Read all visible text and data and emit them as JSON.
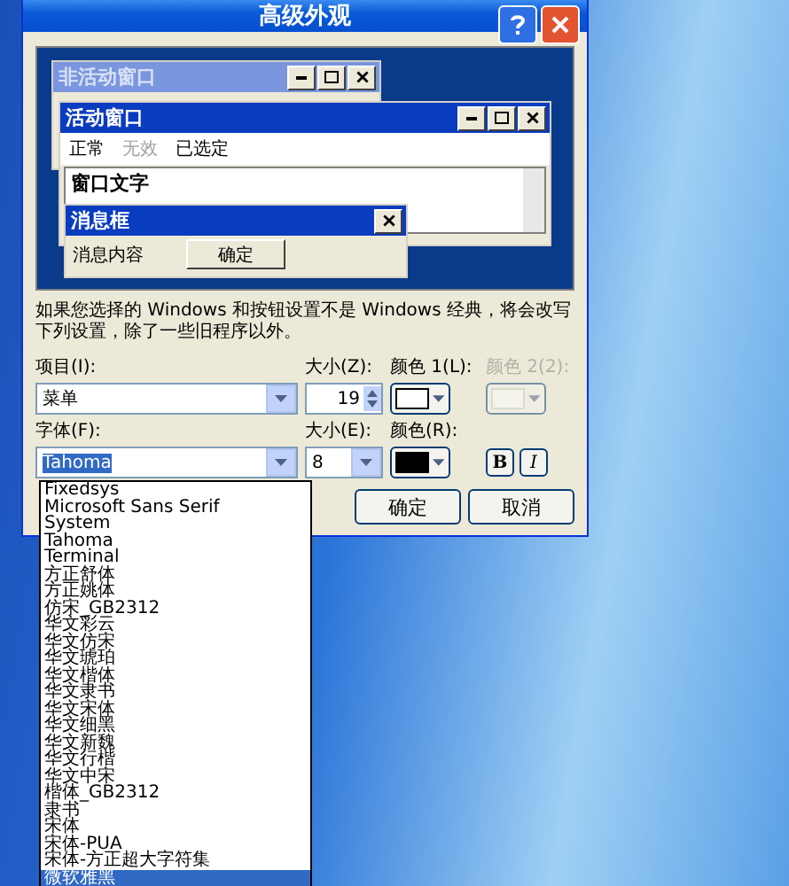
{
  "window": {
    "title": "高级外观"
  },
  "preview": {
    "inactive_window": {
      "title": "非活动窗口"
    },
    "active_window": {
      "title": "活动窗口",
      "menu": [
        {
          "label": "正常",
          "disabled": false
        },
        {
          "label": "无效",
          "disabled": true
        },
        {
          "label": "已选定",
          "disabled": false
        }
      ],
      "text": "窗口文字"
    },
    "message_box": {
      "title": "消息框",
      "text": "消息内容",
      "button": "确定"
    }
  },
  "description": "如果您选择的 Windows 和按钮设置不是 Windows 经典，将会改写下列设置，除了一些旧程序以外。",
  "item": {
    "label": "项目(I):",
    "value": "菜单"
  },
  "item_size": {
    "label": "大小(Z):",
    "value": "19"
  },
  "color1": {
    "label": "颜色 1(L):",
    "color": "#ffffff"
  },
  "color2": {
    "label": "颜色 2(2):",
    "disabled": true
  },
  "font": {
    "label": "字体(F):",
    "value": "Tahoma"
  },
  "font_size": {
    "label": "大小(E):",
    "value": "8"
  },
  "font_color": {
    "label": "颜色(R):",
    "color": "#000000"
  },
  "style_buttons": [
    {
      "label": "B",
      "kind": "bold"
    },
    {
      "label": "I",
      "kind": "italic"
    }
  ],
  "buttons": [
    {
      "label": "确定"
    },
    {
      "label": "取消"
    }
  ],
  "font_list": [
    {
      "label": "Fixedsys",
      "selected": false
    },
    {
      "label": "Microsoft Sans Serif",
      "selected": false
    },
    {
      "label": "System",
      "selected": false
    },
    {
      "label": "Tahoma",
      "selected": false
    },
    {
      "label": "Terminal",
      "selected": false
    },
    {
      "label": "方正舒体",
      "selected": false
    },
    {
      "label": "方正姚体",
      "selected": false
    },
    {
      "label": "仿宋_GB2312",
      "selected": false
    },
    {
      "label": "华文彩云",
      "selected": false
    },
    {
      "label": "华文仿宋",
      "selected": false
    },
    {
      "label": "华文琥珀",
      "selected": false
    },
    {
      "label": "华文楷体",
      "selected": false
    },
    {
      "label": "华文隶书",
      "selected": false
    },
    {
      "label": "华文宋体",
      "selected": false
    },
    {
      "label": "华文细黑",
      "selected": false
    },
    {
      "label": "华文新魏",
      "selected": false
    },
    {
      "label": "华文行楷",
      "selected": false
    },
    {
      "label": "华文中宋",
      "selected": false
    },
    {
      "label": "楷体_GB2312",
      "selected": false
    },
    {
      "label": "隶书",
      "selected": false
    },
    {
      "label": "宋体",
      "selected": false
    },
    {
      "label": "宋体-PUA",
      "selected": false
    },
    {
      "label": "宋体-方正超大字符集",
      "selected": false
    },
    {
      "label": "微软雅黑",
      "selected": true
    }
  ]
}
